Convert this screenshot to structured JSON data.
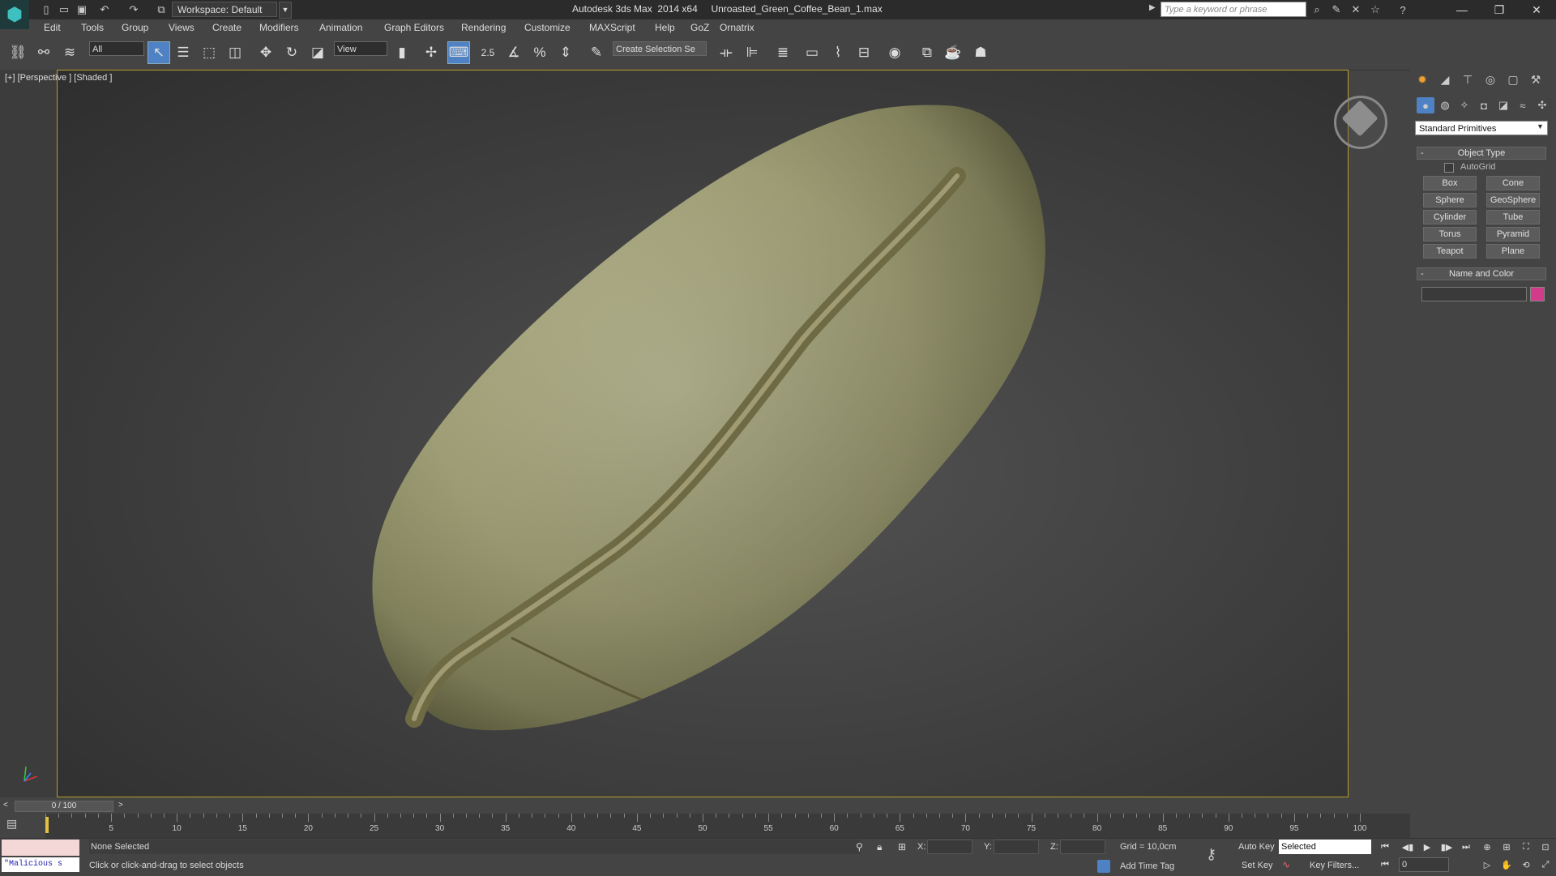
{
  "title_bar": {
    "workspace": "Workspace: Default",
    "app_title": "Autodesk 3ds Max  2014 x64",
    "file_name": "Unroasted_Green_Coffee_Bean_1.max",
    "search_placeholder": "Type a keyword or phrase"
  },
  "menu": [
    "Edit",
    "Tools",
    "Group",
    "Views",
    "Create",
    "Modifiers",
    "Animation",
    "Graph Editors",
    "Rendering",
    "Customize",
    "MAXScript",
    "Help",
    "GoZ",
    "Ornatrix"
  ],
  "toolbar": {
    "selection_filter": "All",
    "ref_coord": "View",
    "snap_label": "2.5",
    "named_selection": "Create Selection Se"
  },
  "viewport": {
    "label": "[+] [Perspective ] [Shaded ]",
    "object": "coffee bean"
  },
  "command_panel": {
    "category": "Standard Primitives",
    "object_type_title": "Object Type",
    "autogrid": "AutoGrid",
    "buttons": [
      "Box",
      "Cone",
      "Sphere",
      "GeoSphere",
      "Cylinder",
      "Tube",
      "Torus",
      "Pyramid",
      "Teapot",
      "Plane"
    ],
    "name_color_title": "Name and Color",
    "object_color": "#d23a8a"
  },
  "time_slider": {
    "position": "0 / 100",
    "tick_labels": [
      "5",
      "10",
      "15",
      "20",
      "25",
      "30",
      "35",
      "40",
      "45",
      "50",
      "55",
      "60",
      "65",
      "70",
      "75",
      "80",
      "85",
      "90",
      "95",
      "100"
    ]
  },
  "status": {
    "maxscript": "\"Malicious s",
    "selection": "None Selected",
    "prompt": "Click or click-and-drag to select objects",
    "x_label": "X:",
    "y_label": "Y:",
    "z_label": "Z:",
    "grid": "Grid = 10,0cm",
    "add_time_tag": "Add Time Tag",
    "auto_key": "Auto Key",
    "set_key": "Set Key",
    "key_mode": "Selected",
    "key_filters": "Key Filters...",
    "current_frame": "0"
  }
}
